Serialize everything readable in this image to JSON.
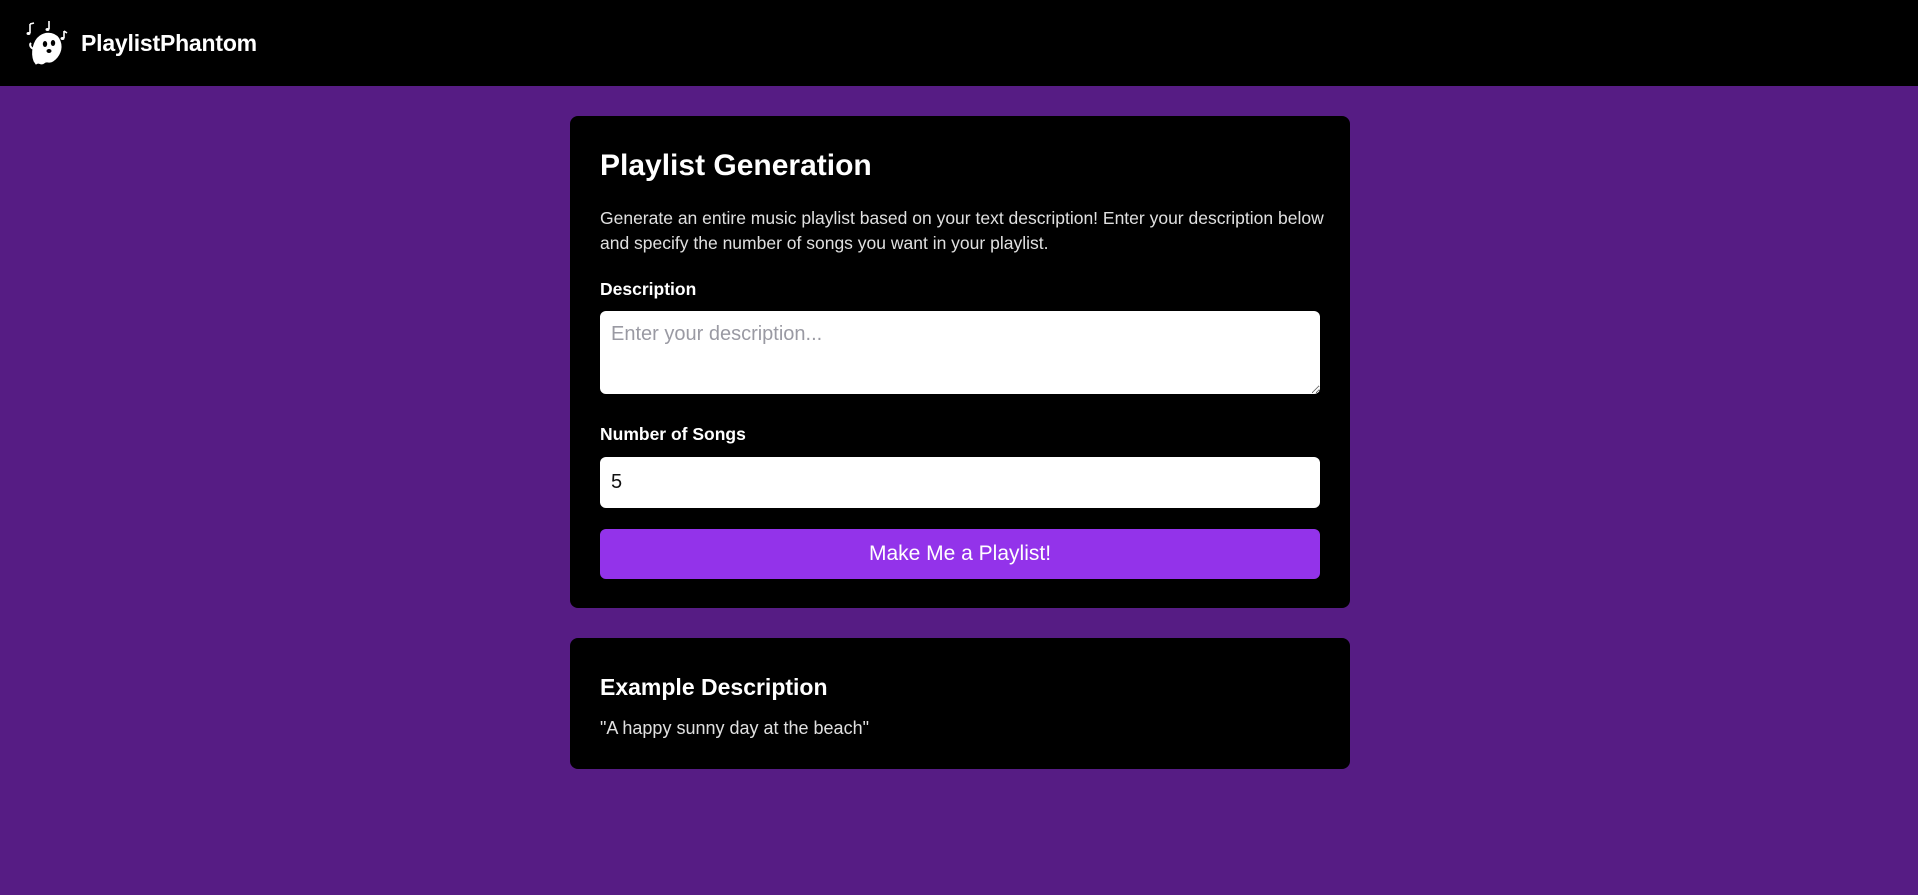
{
  "header": {
    "brand_name": "PlaylistPhantom",
    "logo_icon": "ghost-music-icon",
    "background": "#000000"
  },
  "theme": {
    "page_background": "#561c84",
    "card_background": "#000000",
    "accent": "#9333ea"
  },
  "generator": {
    "title": "Playlist Generation",
    "intro": "Generate an entire music playlist based on your text description! Enter your description below and specify the number of songs you want in your playlist.",
    "description_label": "Description",
    "description_placeholder": "Enter your description...",
    "description_value": "",
    "songs_label": "Number of Songs",
    "songs_value": "5",
    "submit_label": "Make Me a Playlist!"
  },
  "example": {
    "title": "Example Description",
    "text": "\"A happy sunny day at the beach\""
  }
}
